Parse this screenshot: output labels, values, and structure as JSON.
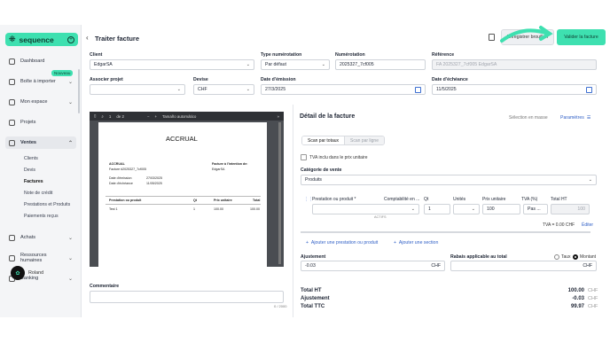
{
  "brand": {
    "name": "sequence",
    "accent": "#3ee0b0"
  },
  "sidebar": {
    "items": [
      {
        "label": "Dashboard",
        "icon": "home-icon"
      },
      {
        "label": "Boîte à importer",
        "icon": "inbox-icon",
        "badge": "Nouveau"
      },
      {
        "label": "Mon espace",
        "icon": "user-icon"
      },
      {
        "label": "Projets",
        "icon": "check-square-icon"
      },
      {
        "label": "Ventes",
        "icon": "sales-icon"
      },
      {
        "label": "Achats",
        "icon": "cart-icon"
      },
      {
        "label": "Ressources humaines",
        "icon": "people-icon"
      },
      {
        "label": "Banking",
        "icon": "bank-icon"
      }
    ],
    "sub_items": [
      "Clients",
      "Devis",
      "Factures",
      "Note de crédit",
      "Prestations et Produits",
      "Paiements reçus"
    ],
    "user": "Roland"
  },
  "header": {
    "title": "Traiter facture",
    "secondary_button": "Enregistrer brouillon",
    "primary_button": "Valider la facture"
  },
  "form": {
    "client_label": "Client",
    "client_value": "EdgarSA",
    "type_label": "Type numérotation",
    "type_value": "Par défaut",
    "num_label": "Numérotation",
    "num_value": "2025327_7cf005",
    "ref_label": "Référence",
    "ref_value": "FA 2025327_7cf005 EdgarSA",
    "projet_label": "Associer projet",
    "devise_label": "Devise",
    "devise_value": "CHF",
    "emission_label": "Date d'émission",
    "emission_value": "27/3/2025",
    "echeance_label": "Date d'échéance",
    "echeance_value": "11/5/2025"
  },
  "pdf": {
    "page": "1",
    "of": "de 2",
    "zoom": "Tamaño automático",
    "doc_title": "ACCRUAL",
    "company": "ACCRUAL",
    "invoice_no": "Facture #2025327_7cf005",
    "attention": "Facture à l'intention de:",
    "client": "EdgarSA",
    "date_em_label": "Date d'émission",
    "date_em": "27/03/2025",
    "date_ech_label": "Date d'échéance",
    "date_ech": "11/05/2025",
    "col_item": "Prestation ou produit",
    "col_qty": "Qt",
    "col_pu": "Prix unitaire",
    "col_total": "Total",
    "row_item": "Test 1",
    "row_qty": "1",
    "row_pu": "100.00",
    "row_total": "100.00"
  },
  "comment": {
    "label": "Commentaire",
    "counter": "0 / 2000"
  },
  "detail": {
    "title": "Détail de la facture",
    "selection": "Sélection en masse",
    "params": "Paramètres",
    "scan_total": "Scan par totaux",
    "scan_line": "Scan par ligne",
    "tva_checkbox": "TVA inclu dans le prix unitaire",
    "category_label": "Catégorie de vente",
    "category_value": "Produits",
    "col_product": "Prestation ou produit *",
    "col_compta": "Comptabilité en ...",
    "col_qt": "Qt",
    "col_unit": "Unités",
    "col_pu": "Prix unitaire",
    "col_tva": "TVA (%)",
    "col_ht": "Total HT",
    "row_qt": "1",
    "row_pu": "100",
    "row_tva": "Pas ...",
    "row_ht": "100",
    "row_sub": "ACTIFS",
    "tva_sum": "TVA = 0.00 CHF",
    "edit": "Éditer",
    "add_product": "Ajouter une prestation ou produit",
    "add_section": "Ajouter une section",
    "ajust_label": "Ajustement",
    "ajust_value": "-0.03",
    "ajust_cur": "CHF",
    "rabais_label": "Rabais applicable au total",
    "rabais_cur": "CHF",
    "taux": "Taux",
    "montant": "Montant",
    "total_ht_label": "Total HT",
    "total_ht": "100.00",
    "ajust_total_label": "Ajustement",
    "ajust_total": "-0.03",
    "ttc_label": "Total TTC",
    "ttc": "99.97",
    "cur": "CHF"
  }
}
